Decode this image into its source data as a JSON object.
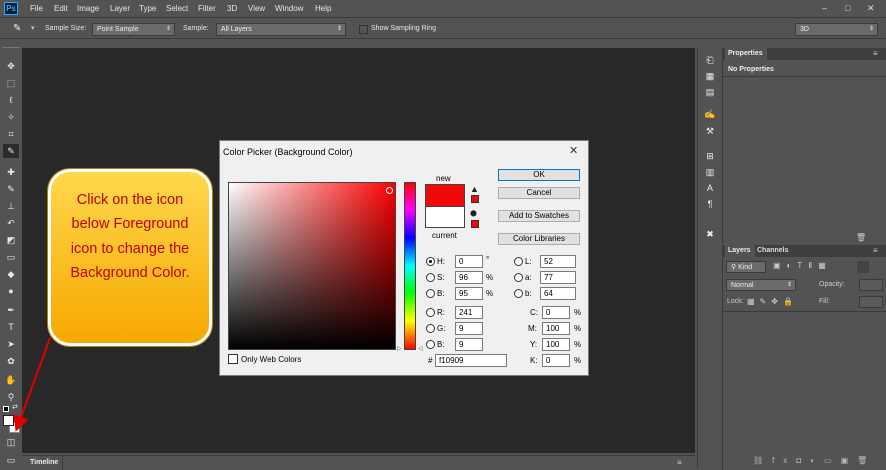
{
  "app": {
    "logo": "Ps"
  },
  "menu": [
    "File",
    "Edit",
    "Image",
    "Layer",
    "Type",
    "Select",
    "Filter",
    "3D",
    "View",
    "Window",
    "Help"
  ],
  "window_controls": [
    "–",
    "□",
    "✕"
  ],
  "options_bar": {
    "sample_size_label": "Sample Size:",
    "sample_size_value": "Point Sample",
    "sample_label": "Sample:",
    "sample_value": "All Layers",
    "sampling_ring_label": "Show Sampling Ring",
    "workspace_value": "3D"
  },
  "timeline": {
    "label": "Timeline"
  },
  "properties_panel": {
    "tab": "Properties",
    "content": "No Properties"
  },
  "layers_panel": {
    "tabs": [
      "Layers",
      "Channels"
    ],
    "filter_kind": "Kind",
    "blend_mode": "Normal",
    "opacity_label": "Opacity:",
    "lock_label": "Lock:",
    "fill_label": "Fill:"
  },
  "dialog": {
    "title": "Color Picker (Background Color)",
    "new_label": "new",
    "current_label": "current",
    "only_web_colors": "Only Web Colors",
    "buttons": {
      "ok": "OK",
      "cancel": "Cancel",
      "add_to_swatches": "Add to Swatches",
      "color_libraries": "Color Libraries"
    },
    "hsb": [
      {
        "label": "H:",
        "value": "0",
        "unit": "°"
      },
      {
        "label": "S:",
        "value": "96",
        "unit": "%"
      },
      {
        "label": "B:",
        "value": "95",
        "unit": "%"
      }
    ],
    "rgb": [
      {
        "label": "R:",
        "value": "241"
      },
      {
        "label": "G:",
        "value": "9"
      },
      {
        "label": "B:",
        "value": "9"
      }
    ],
    "lab": [
      {
        "label": "L:",
        "value": "52"
      },
      {
        "label": "a:",
        "value": "77"
      },
      {
        "label": "b:",
        "value": "64"
      }
    ],
    "cmyk": [
      {
        "label": "C:",
        "value": "0",
        "unit": "%"
      },
      {
        "label": "M:",
        "value": "100",
        "unit": "%"
      },
      {
        "label": "Y:",
        "value": "100",
        "unit": "%"
      },
      {
        "label": "K:",
        "value": "0",
        "unit": "%"
      }
    ],
    "hex_label": "#",
    "hex_value": "f10909",
    "new_color": "#f10909",
    "current_color": "#ffffff"
  },
  "callout": {
    "text": "Click on the icon below Foreground icon to change the Background Color."
  }
}
